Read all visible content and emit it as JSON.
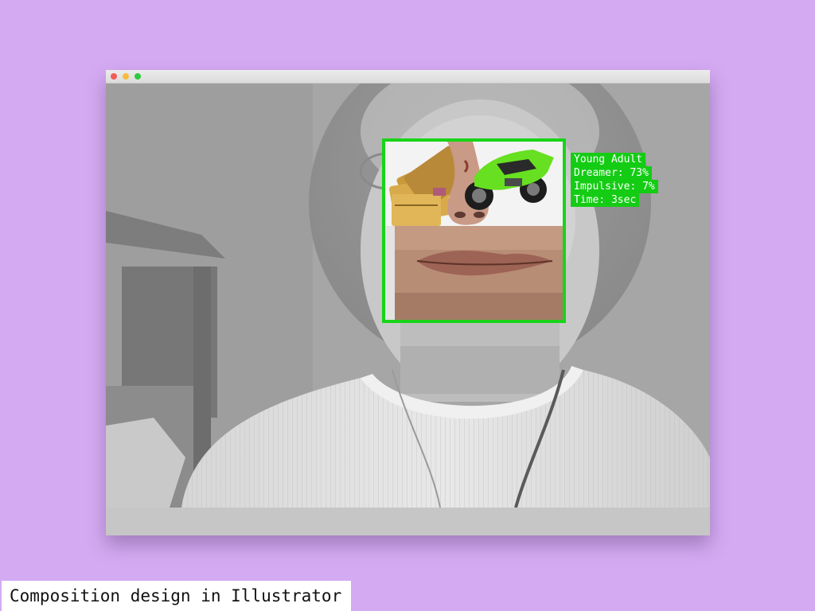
{
  "window": {
    "traffic_lights": [
      {
        "name": "close",
        "color": "#ef5e55"
      },
      {
        "name": "minimize",
        "color": "#f3bd3b"
      },
      {
        "name": "maximize",
        "color": "#30c93f"
      }
    ]
  },
  "overlay": {
    "box_color": "#18d418",
    "tags": [
      "Young Adult",
      "Dreamer: 73%",
      "Impulsive: 7%",
      "Time: 3sec"
    ],
    "collage_images": [
      "credit-cards",
      "nose",
      "green-motorcycle",
      "mouth"
    ]
  },
  "caption": "Composition design in Illustrator",
  "colors": {
    "background": "#d4aaf2",
    "tag_background": "#14cc14",
    "tag_text": "#ffffff"
  }
}
